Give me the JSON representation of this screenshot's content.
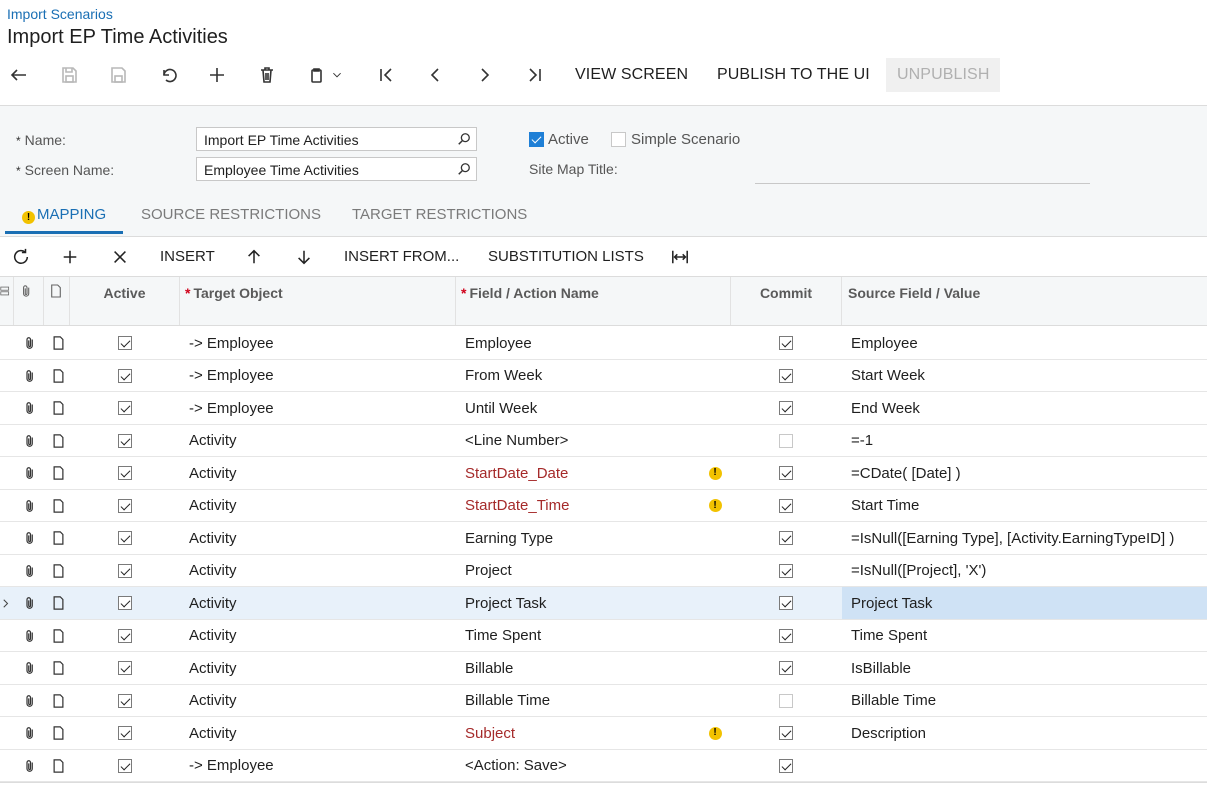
{
  "breadcrumb": "Import Scenarios",
  "title": "Import EP Time Activities",
  "toolbar": {
    "view_screen": "VIEW SCREEN",
    "publish": "PUBLISH TO THE UI",
    "unpublish": "UNPUBLISH"
  },
  "form": {
    "name_label": "Name:",
    "name_value": "Import EP Time Activities",
    "screen_label": "Screen Name:",
    "screen_value": "Employee Time Activities",
    "active_label": "Active",
    "active_checked": true,
    "simple_label": "Simple Scenario",
    "simple_checked": false,
    "sitemap_label": "Site Map Title:",
    "sitemap_value": "",
    "required_mark": "*"
  },
  "tabs": [
    {
      "label": "MAPPING",
      "active": true,
      "warning": true
    },
    {
      "label": "SOURCE RESTRICTIONS",
      "active": false
    },
    {
      "label": "TARGET RESTRICTIONS",
      "active": false
    }
  ],
  "grid_toolbar": {
    "insert": "INSERT",
    "insert_from": "INSERT FROM...",
    "substitution_lists": "SUBSTITUTION LISTS"
  },
  "columns": {
    "active": "Active",
    "target_object": "Target Object",
    "field_action": "Field / Action Name",
    "commit": "Commit",
    "source": "Source Field / Value",
    "required_mark": "*"
  },
  "rows": [
    {
      "active": true,
      "target": "-> Employee",
      "field": "Employee",
      "warn": false,
      "commit": true,
      "source": "Employee"
    },
    {
      "active": true,
      "target": "-> Employee",
      "field": "From Week",
      "warn": false,
      "commit": true,
      "source": "Start Week"
    },
    {
      "active": true,
      "target": "-> Employee",
      "field": "Until Week",
      "warn": false,
      "commit": true,
      "source": "End Week"
    },
    {
      "active": true,
      "target": "Activity",
      "field": "<Line Number>",
      "warn": false,
      "commit": false,
      "source": "=-1"
    },
    {
      "active": true,
      "target": "Activity",
      "field": "StartDate_Date",
      "warn": true,
      "commit": true,
      "source": "=CDate( [Date] )"
    },
    {
      "active": true,
      "target": "Activity",
      "field": "StartDate_Time",
      "warn": true,
      "commit": true,
      "source": "Start Time"
    },
    {
      "active": true,
      "target": "Activity",
      "field": "Earning Type",
      "warn": false,
      "commit": true,
      "source": "=IsNull([Earning Type], [Activity.EarningTypeID] )"
    },
    {
      "active": true,
      "target": "Activity",
      "field": "Project",
      "warn": false,
      "commit": true,
      "source": "=IsNull([Project], 'X')"
    },
    {
      "active": true,
      "target": "Activity",
      "field": "Project Task",
      "warn": false,
      "commit": true,
      "source": "Project Task",
      "selected": true
    },
    {
      "active": true,
      "target": "Activity",
      "field": "Time Spent",
      "warn": false,
      "commit": true,
      "source": "Time Spent"
    },
    {
      "active": true,
      "target": "Activity",
      "field": "Billable",
      "warn": false,
      "commit": true,
      "source": "IsBillable"
    },
    {
      "active": true,
      "target": "Activity",
      "field": "Billable Time",
      "warn": false,
      "commit": false,
      "source": "Billable Time"
    },
    {
      "active": true,
      "target": "Activity",
      "field": "Subject",
      "warn": true,
      "commit": true,
      "source": "Description"
    },
    {
      "active": true,
      "target": "-> Employee",
      "field": "<Action: Save>",
      "warn": false,
      "commit": true,
      "source": ""
    }
  ],
  "warning_glyph": "!",
  "colors": {
    "accent": "#1a6fb4",
    "warning": "#f2c200",
    "warn_text": "#a52a2a",
    "selected_row": "#e8f1fa"
  }
}
